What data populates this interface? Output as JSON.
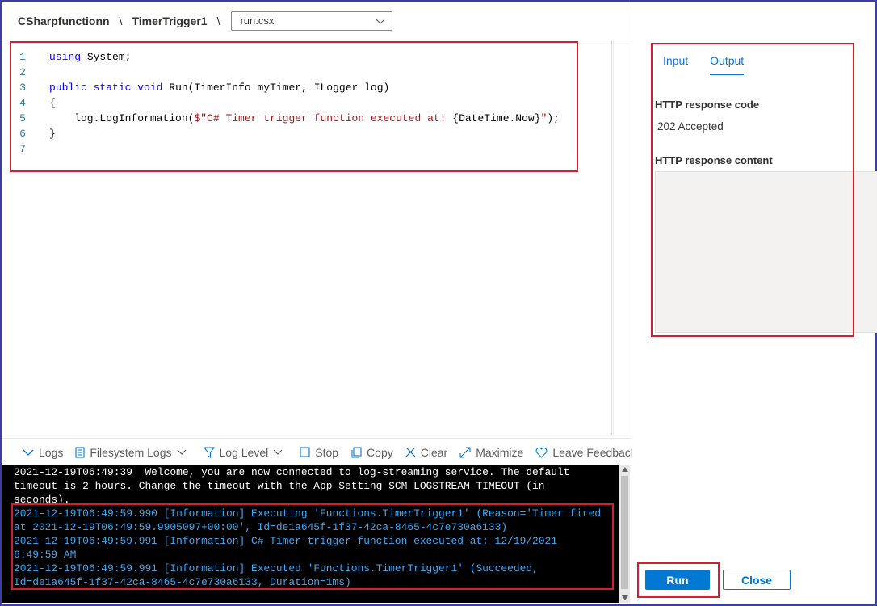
{
  "breadcrumb": {
    "app": "CSharpfunctionn",
    "sep1": "\\",
    "function": "TimerTrigger1",
    "sep2": "\\",
    "file": "run.csx"
  },
  "editor": {
    "lines": [
      {
        "n": "1",
        "parts": [
          {
            "t": "using",
            "c": "kw"
          },
          {
            "t": " System;",
            "c": ""
          }
        ]
      },
      {
        "n": "2",
        "parts": []
      },
      {
        "n": "3",
        "parts": [
          {
            "t": "public",
            "c": "kw"
          },
          {
            "t": " ",
            "c": ""
          },
          {
            "t": "static",
            "c": "kw"
          },
          {
            "t": " ",
            "c": ""
          },
          {
            "t": "void",
            "c": "kw"
          },
          {
            "t": " Run(TimerInfo myTimer, ILogger log)",
            "c": ""
          }
        ]
      },
      {
        "n": "4",
        "parts": [
          {
            "t": "{",
            "c": ""
          }
        ]
      },
      {
        "n": "5",
        "parts": [
          {
            "t": "    log.LogInformation(",
            "c": ""
          },
          {
            "t": "$\"C# Timer trigger function executed at: ",
            "c": "str"
          },
          {
            "t": "{DateTime.Now}",
            "c": ""
          },
          {
            "t": "\"",
            "c": "str"
          },
          {
            "t": ");",
            "c": ""
          }
        ]
      },
      {
        "n": "6",
        "parts": [
          {
            "t": "}",
            "c": ""
          }
        ]
      },
      {
        "n": "7",
        "parts": []
      }
    ]
  },
  "log_toolbar": {
    "logs": "Logs",
    "filesystem_logs": "Filesystem Logs",
    "log_level": "Log Level",
    "stop": "Stop",
    "copy": "Copy",
    "clear": "Clear",
    "maximize": "Maximize",
    "feedback": "Leave Feedback"
  },
  "console": {
    "lines": [
      {
        "text": "2021-12-19T06:49:39  Welcome, you are now connected to log-streaming service. The default",
        "color": "white"
      },
      {
        "text": "timeout is 2 hours. Change the timeout with the App Setting SCM_LOGSTREAM_TIMEOUT (in",
        "color": "white"
      },
      {
        "text": "seconds).",
        "color": "white"
      },
      {
        "text": "2021-12-19T06:49:59.990 [Information] Executing 'Functions.TimerTrigger1' (Reason='Timer fired",
        "color": "blue"
      },
      {
        "text": "at 2021-12-19T06:49:59.9905097+00:00', Id=de1a645f-1f37-42ca-8465-4c7e730a6133)",
        "color": "blue"
      },
      {
        "text": "2021-12-19T06:49:59.991 [Information] C# Timer trigger function executed at: 12/19/2021",
        "color": "blue"
      },
      {
        "text": "6:49:59 AM",
        "color": "blue"
      },
      {
        "text": "2021-12-19T06:49:59.991 [Information] Executed 'Functions.TimerTrigger1' (Succeeded,",
        "color": "blue"
      },
      {
        "text": "Id=de1a645f-1f37-42ca-8465-4c7e730a6133, Duration=1ms)",
        "color": "blue"
      }
    ]
  },
  "panel": {
    "tab_input": "Input",
    "tab_output": "Output",
    "active_tab": "Output",
    "response_code_label": "HTTP response code",
    "response_code_value": "202 Accepted",
    "response_content_label": "HTTP response content",
    "response_content_value": "",
    "run_label": "Run",
    "close_label": "Close"
  },
  "colors": {
    "accent": "#0078d4",
    "highlight_box": "#d2202f",
    "console_bg": "#000000",
    "console_info": "#3ea8f5"
  }
}
